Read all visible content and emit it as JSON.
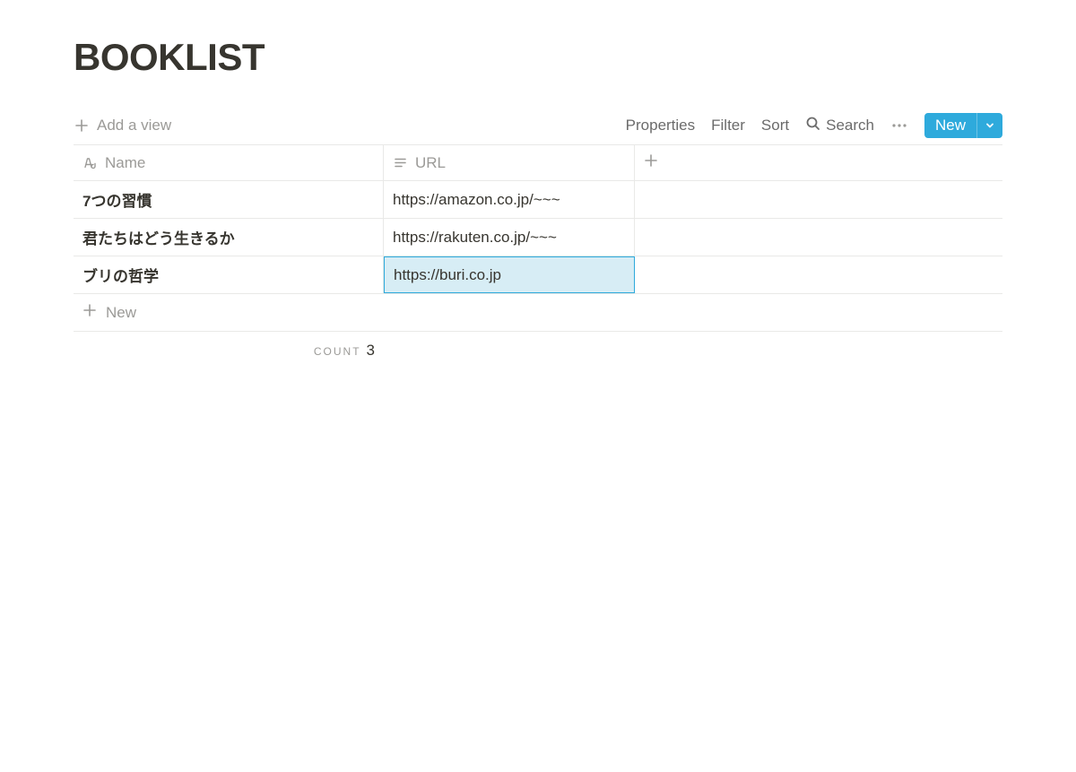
{
  "title": "BOOKLIST",
  "toolbar": {
    "add_view": "Add a view",
    "properties": "Properties",
    "filter": "Filter",
    "sort": "Sort",
    "search": "Search",
    "new": "New"
  },
  "columns": {
    "name": "Name",
    "url": "URL"
  },
  "rows": [
    {
      "name": "7つの習慣",
      "url": "https://amazon.co.jp/~~~",
      "editing": false
    },
    {
      "name": "君たちはどう生きるか",
      "url": "https://rakuten.co.jp/~~~",
      "editing": false
    },
    {
      "name": "ブリの哲学",
      "url": "https://buri.co.jp",
      "editing": true
    }
  ],
  "new_row": "New",
  "count": {
    "label": "COUNT",
    "value": "3"
  }
}
